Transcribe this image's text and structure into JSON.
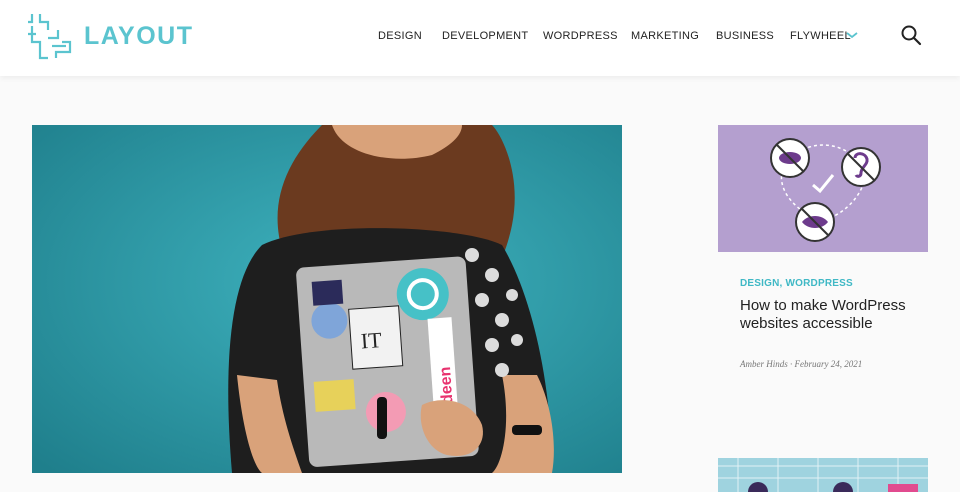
{
  "brand": {
    "name": "LAYOUT",
    "accent": "#5bc4cf"
  },
  "nav": {
    "items": [
      "DESIGN",
      "DEVELOPMENT",
      "WORDPRESS",
      "MARKETING",
      "BUSINESS",
      "FLYWHEEL"
    ],
    "dropdown_icon": "chevron-down-icon",
    "search_icon": "search-icon"
  },
  "hero": {
    "image_description_icon": "photo"
  },
  "sidebar_card": {
    "categories": "DESIGN, WORDPRESS",
    "title": "How to make WordPress websites accessible",
    "meta": "Amber Hinds · February 24, 2021",
    "image_bg": "#b49fcf"
  },
  "colors": {
    "teal": "#3fb8c5",
    "hero_bg": "#2c9aa6"
  }
}
